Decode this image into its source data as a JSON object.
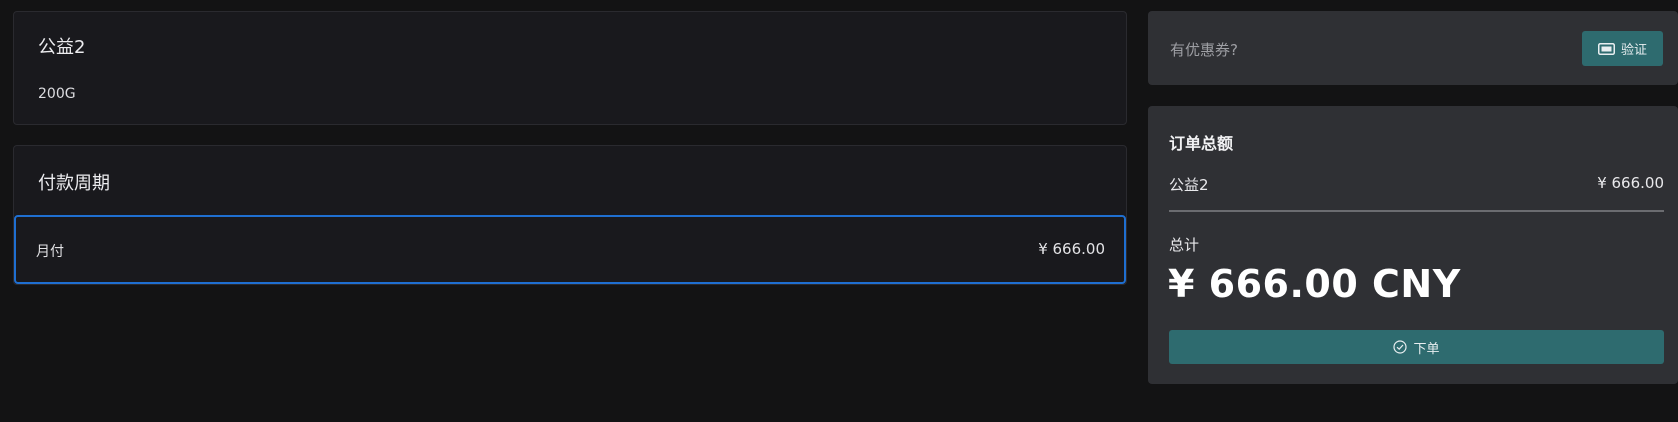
{
  "product": {
    "name": "公益2",
    "description": "200G"
  },
  "billing": {
    "title": "付款周期",
    "options": [
      {
        "label": "月付",
        "price": "¥ 666.00",
        "selected": true
      }
    ]
  },
  "coupon": {
    "prompt": "有优惠券?",
    "verify_label": "验证",
    "verify_icon": "ticket-icon"
  },
  "summary": {
    "title": "订单总额",
    "items": [
      {
        "name": "公益2",
        "price": "¥ 666.00"
      }
    ],
    "total_label": "总计",
    "total_amount": "¥ 666.00 CNY",
    "order_label": "下单",
    "order_icon": "check-circle-icon"
  },
  "colors": {
    "accent": "#2e6b6f",
    "selected_border": "#1f6fd1",
    "background": "#131314",
    "card": "#19191d",
    "panel": "#2f3034"
  }
}
